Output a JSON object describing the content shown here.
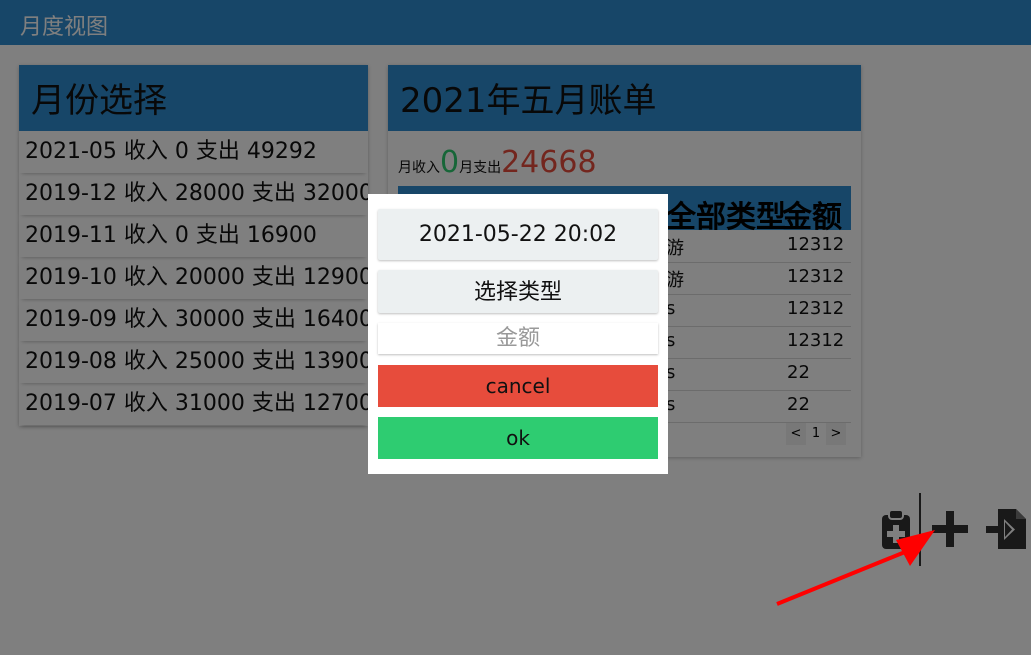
{
  "topbar": {
    "title": "月度视图"
  },
  "month_panel": {
    "title": "月份选择",
    "items": [
      {
        "label": "2021-05 收入 0 支出 49292"
      },
      {
        "label": "2019-12 收入 28000 支出 32000"
      },
      {
        "label": "2019-11 收入 0 支出 16900"
      },
      {
        "label": "2019-10 收入 20000 支出 12900"
      },
      {
        "label": "2019-09 收入 30000 支出 16400"
      },
      {
        "label": "2019-08 收入 25000 支出 13900"
      },
      {
        "label": "2019-07 收入 31000 支出 12700"
      }
    ]
  },
  "bill_panel": {
    "title": "2021年五月账单",
    "income_label": "月收入",
    "income_value": "0",
    "expense_label": "月支出",
    "expense_value": "24668",
    "columns": [
      "全部类型",
      "金额"
    ],
    "rows": [
      {
        "type": "游",
        "amount": "12312"
      },
      {
        "type": "游",
        "amount": "12312"
      },
      {
        "type": "s",
        "amount": "12312"
      },
      {
        "type": "s",
        "amount": "12312"
      },
      {
        "type": "s",
        "amount": "22"
      },
      {
        "type": "s",
        "amount": "22"
      }
    ],
    "pager": {
      "prev": "<",
      "page": "1",
      "next": ">"
    }
  },
  "modal": {
    "datetime": "2021-05-22 20:02",
    "type_select": "选择类型",
    "amount_placeholder": "金额",
    "cancel_label": "cancel",
    "ok_label": "ok"
  },
  "fab_bar": {
    "icons": [
      "clipboard-plus-icon",
      "plus-icon",
      "file-import-icon"
    ]
  },
  "colors": {
    "header_blue": "#2f8cd0",
    "income_green": "#2ecc71",
    "expense_red": "#e74c3c",
    "cancel_red": "#e74c3c",
    "ok_green": "#2ecc71",
    "annotation_arrow": "#ff0000"
  }
}
